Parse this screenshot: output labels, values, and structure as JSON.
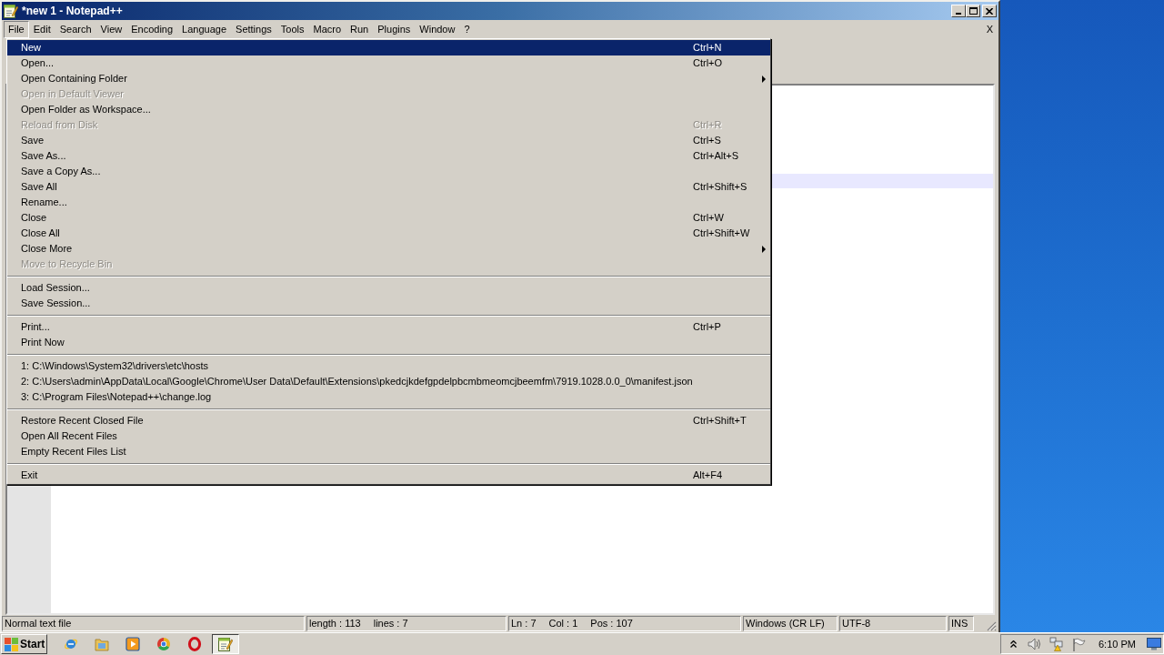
{
  "window": {
    "title": "*new 1 - Notepad++"
  },
  "menu_bar": {
    "items": [
      {
        "label": "File",
        "selected": true
      },
      {
        "label": "Edit",
        "selected": false
      },
      {
        "label": "Search",
        "selected": false
      },
      {
        "label": "View",
        "selected": false
      },
      {
        "label": "Encoding",
        "selected": false
      },
      {
        "label": "Language",
        "selected": false
      },
      {
        "label": "Settings",
        "selected": false
      },
      {
        "label": "Tools",
        "selected": false
      },
      {
        "label": "Macro",
        "selected": false
      },
      {
        "label": "Run",
        "selected": false
      },
      {
        "label": "Plugins",
        "selected": false
      },
      {
        "label": "Window",
        "selected": false
      },
      {
        "label": "?",
        "selected": false
      }
    ],
    "close_document": "X"
  },
  "file_menu": {
    "groups": [
      {
        "items": [
          {
            "label": "New",
            "shortcut": "Ctrl+N",
            "selected": true,
            "disabled": false,
            "submenu": false
          },
          {
            "label": "Open...",
            "shortcut": "Ctrl+O",
            "selected": false,
            "disabled": false,
            "submenu": false
          },
          {
            "label": "Open Containing Folder",
            "selected": false,
            "disabled": false,
            "submenu": true
          },
          {
            "label": "Open in Default Viewer",
            "selected": false,
            "disabled": true,
            "submenu": false
          },
          {
            "label": "Open Folder as Workspace...",
            "selected": false,
            "disabled": false,
            "submenu": false
          },
          {
            "label": "Reload from Disk",
            "shortcut": "Ctrl+R",
            "selected": false,
            "disabled": true,
            "submenu": false
          },
          {
            "label": "Save",
            "shortcut": "Ctrl+S",
            "selected": false,
            "disabled": false,
            "submenu": false
          },
          {
            "label": "Save As...",
            "shortcut": "Ctrl+Alt+S",
            "selected": false,
            "disabled": false,
            "submenu": false
          },
          {
            "label": "Save a Copy As...",
            "selected": false,
            "disabled": false,
            "submenu": false
          },
          {
            "label": "Save All",
            "shortcut": "Ctrl+Shift+S",
            "selected": false,
            "disabled": false,
            "submenu": false
          },
          {
            "label": "Rename...",
            "selected": false,
            "disabled": false,
            "submenu": false
          },
          {
            "label": "Close",
            "shortcut": "Ctrl+W",
            "selected": false,
            "disabled": false,
            "submenu": false
          },
          {
            "label": "Close All",
            "shortcut": "Ctrl+Shift+W",
            "selected": false,
            "disabled": false,
            "submenu": false
          },
          {
            "label": "Close More",
            "selected": false,
            "disabled": false,
            "submenu": true
          },
          {
            "label": "Move to Recycle Bin",
            "selected": false,
            "disabled": true,
            "submenu": false
          }
        ]
      },
      {
        "items": [
          {
            "label": "Load Session...",
            "selected": false,
            "disabled": false,
            "submenu": false
          },
          {
            "label": "Save Session...",
            "selected": false,
            "disabled": false,
            "submenu": false
          }
        ]
      },
      {
        "items": [
          {
            "label": "Print...",
            "shortcut": "Ctrl+P",
            "selected": false,
            "disabled": false,
            "submenu": false
          },
          {
            "label": "Print Now",
            "selected": false,
            "disabled": false,
            "submenu": false
          }
        ]
      },
      {
        "items": [
          {
            "label": "1: C:\\Windows\\System32\\drivers\\etc\\hosts",
            "selected": false,
            "disabled": false,
            "submenu": false
          },
          {
            "label": "2: C:\\Users\\admin\\AppData\\Local\\Google\\Chrome\\User Data\\Default\\Extensions\\pkedcjkdefgpdelpbcmbmeomcjbeemfm\\7919.1028.0.0_0\\manifest.json",
            "selected": false,
            "disabled": false,
            "submenu": false
          },
          {
            "label": "3: C:\\Program Files\\Notepad++\\change.log",
            "selected": false,
            "disabled": false,
            "submenu": false
          }
        ]
      },
      {
        "items": [
          {
            "label": "Restore Recent Closed File",
            "shortcut": "Ctrl+Shift+T",
            "selected": false,
            "disabled": false,
            "submenu": false
          },
          {
            "label": "Open All Recent Files",
            "selected": false,
            "disabled": false,
            "submenu": false
          },
          {
            "label": "Empty Recent Files List",
            "selected": false,
            "disabled": false,
            "submenu": false
          }
        ]
      },
      {
        "items": [
          {
            "label": "Exit",
            "shortcut": "Alt+F4",
            "selected": false,
            "disabled": false,
            "submenu": false
          }
        ]
      }
    ]
  },
  "status_bar": {
    "panels": [
      {
        "texts": [
          "Normal text file"
        ]
      },
      {
        "texts": [
          "length : 113",
          "lines : 7"
        ]
      },
      {
        "texts": [
          "Ln : 7",
          "Col : 1",
          "Pos : 107"
        ]
      },
      {
        "texts": [
          "Windows (CR LF)"
        ]
      },
      {
        "texts": [
          "UTF-8"
        ]
      },
      {
        "texts": [
          "INS"
        ]
      }
    ]
  },
  "taskbar": {
    "start_label": "Start",
    "apps": [
      {
        "kind": "globe",
        "selected": false
      },
      {
        "kind": "folder",
        "selected": false
      },
      {
        "kind": "player",
        "selected": false
      },
      {
        "kind": "wheel",
        "selected": false
      },
      {
        "kind": "ring",
        "selected": false
      },
      {
        "kind": "notepad",
        "selected": true
      }
    ],
    "clock": "6:10 PM"
  }
}
